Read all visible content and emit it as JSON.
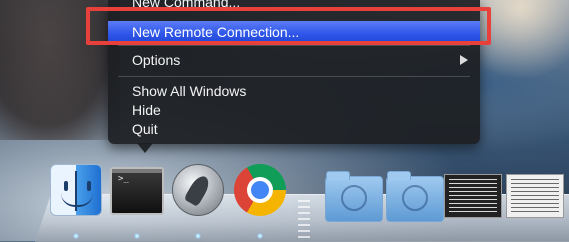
{
  "menu": {
    "cut_item": "New Command...",
    "highlighted_item": "New Remote Connection...",
    "options_label": "Options",
    "show_all_label": "Show All Windows",
    "hide_label": "Hide",
    "quit_label": "Quit"
  },
  "annotation": {
    "color": "#e8413c"
  },
  "dock": {
    "items": [
      {
        "icon": "finder-icon",
        "running": true
      },
      {
        "icon": "terminal-icon",
        "running": true,
        "prompt": ">_"
      },
      {
        "icon": "launchpad-icon",
        "running": true
      },
      {
        "icon": "chrome-icon",
        "running": true
      },
      {
        "icon": "applications-folder-icon",
        "running": false
      },
      {
        "icon": "downloads-folder-icon",
        "running": false
      },
      {
        "icon": "document-thumbnail-icon",
        "running": false
      },
      {
        "icon": "document-thumbnail-icon",
        "running": false
      }
    ]
  },
  "colors": {
    "highlight": "#2d55e8",
    "menu_bg": "#1c1e22",
    "menu_text": "#f4f4f4"
  }
}
